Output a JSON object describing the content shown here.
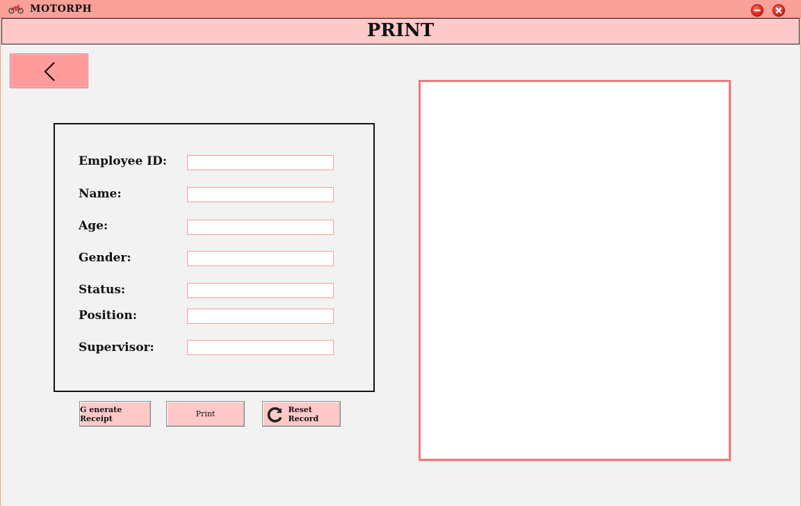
{
  "window": {
    "title": "MOTORPH",
    "icon": "motorcycle-icon",
    "controls": [
      "minimize-icon",
      "close-icon"
    ]
  },
  "header": {
    "title": "PRINT"
  },
  "back_button": {
    "icon": "chevron-left-icon"
  },
  "form": {
    "fields": [
      {
        "label": "Employee ID:",
        "value": ""
      },
      {
        "label": "Name:",
        "value": ""
      },
      {
        "label": "Age:",
        "value": ""
      },
      {
        "label": "Gender:",
        "value": ""
      },
      {
        "label": "Status:",
        "value": ""
      },
      {
        "label": "Position:",
        "value": ""
      },
      {
        "label": "Supervisor:",
        "value": ""
      }
    ]
  },
  "actions": {
    "generate_label": "G enerate Receipt",
    "print_label": "Print",
    "reset_label": "Reset Record",
    "reset_icon": "refresh-icon"
  },
  "receipt": {
    "content": ""
  },
  "colors": {
    "titlebar": "#f9a099",
    "header": "#ffc9c9",
    "back_button": "#ff9b9b",
    "receipt_border": "#f07a78",
    "input_border": "#f39c9c"
  }
}
